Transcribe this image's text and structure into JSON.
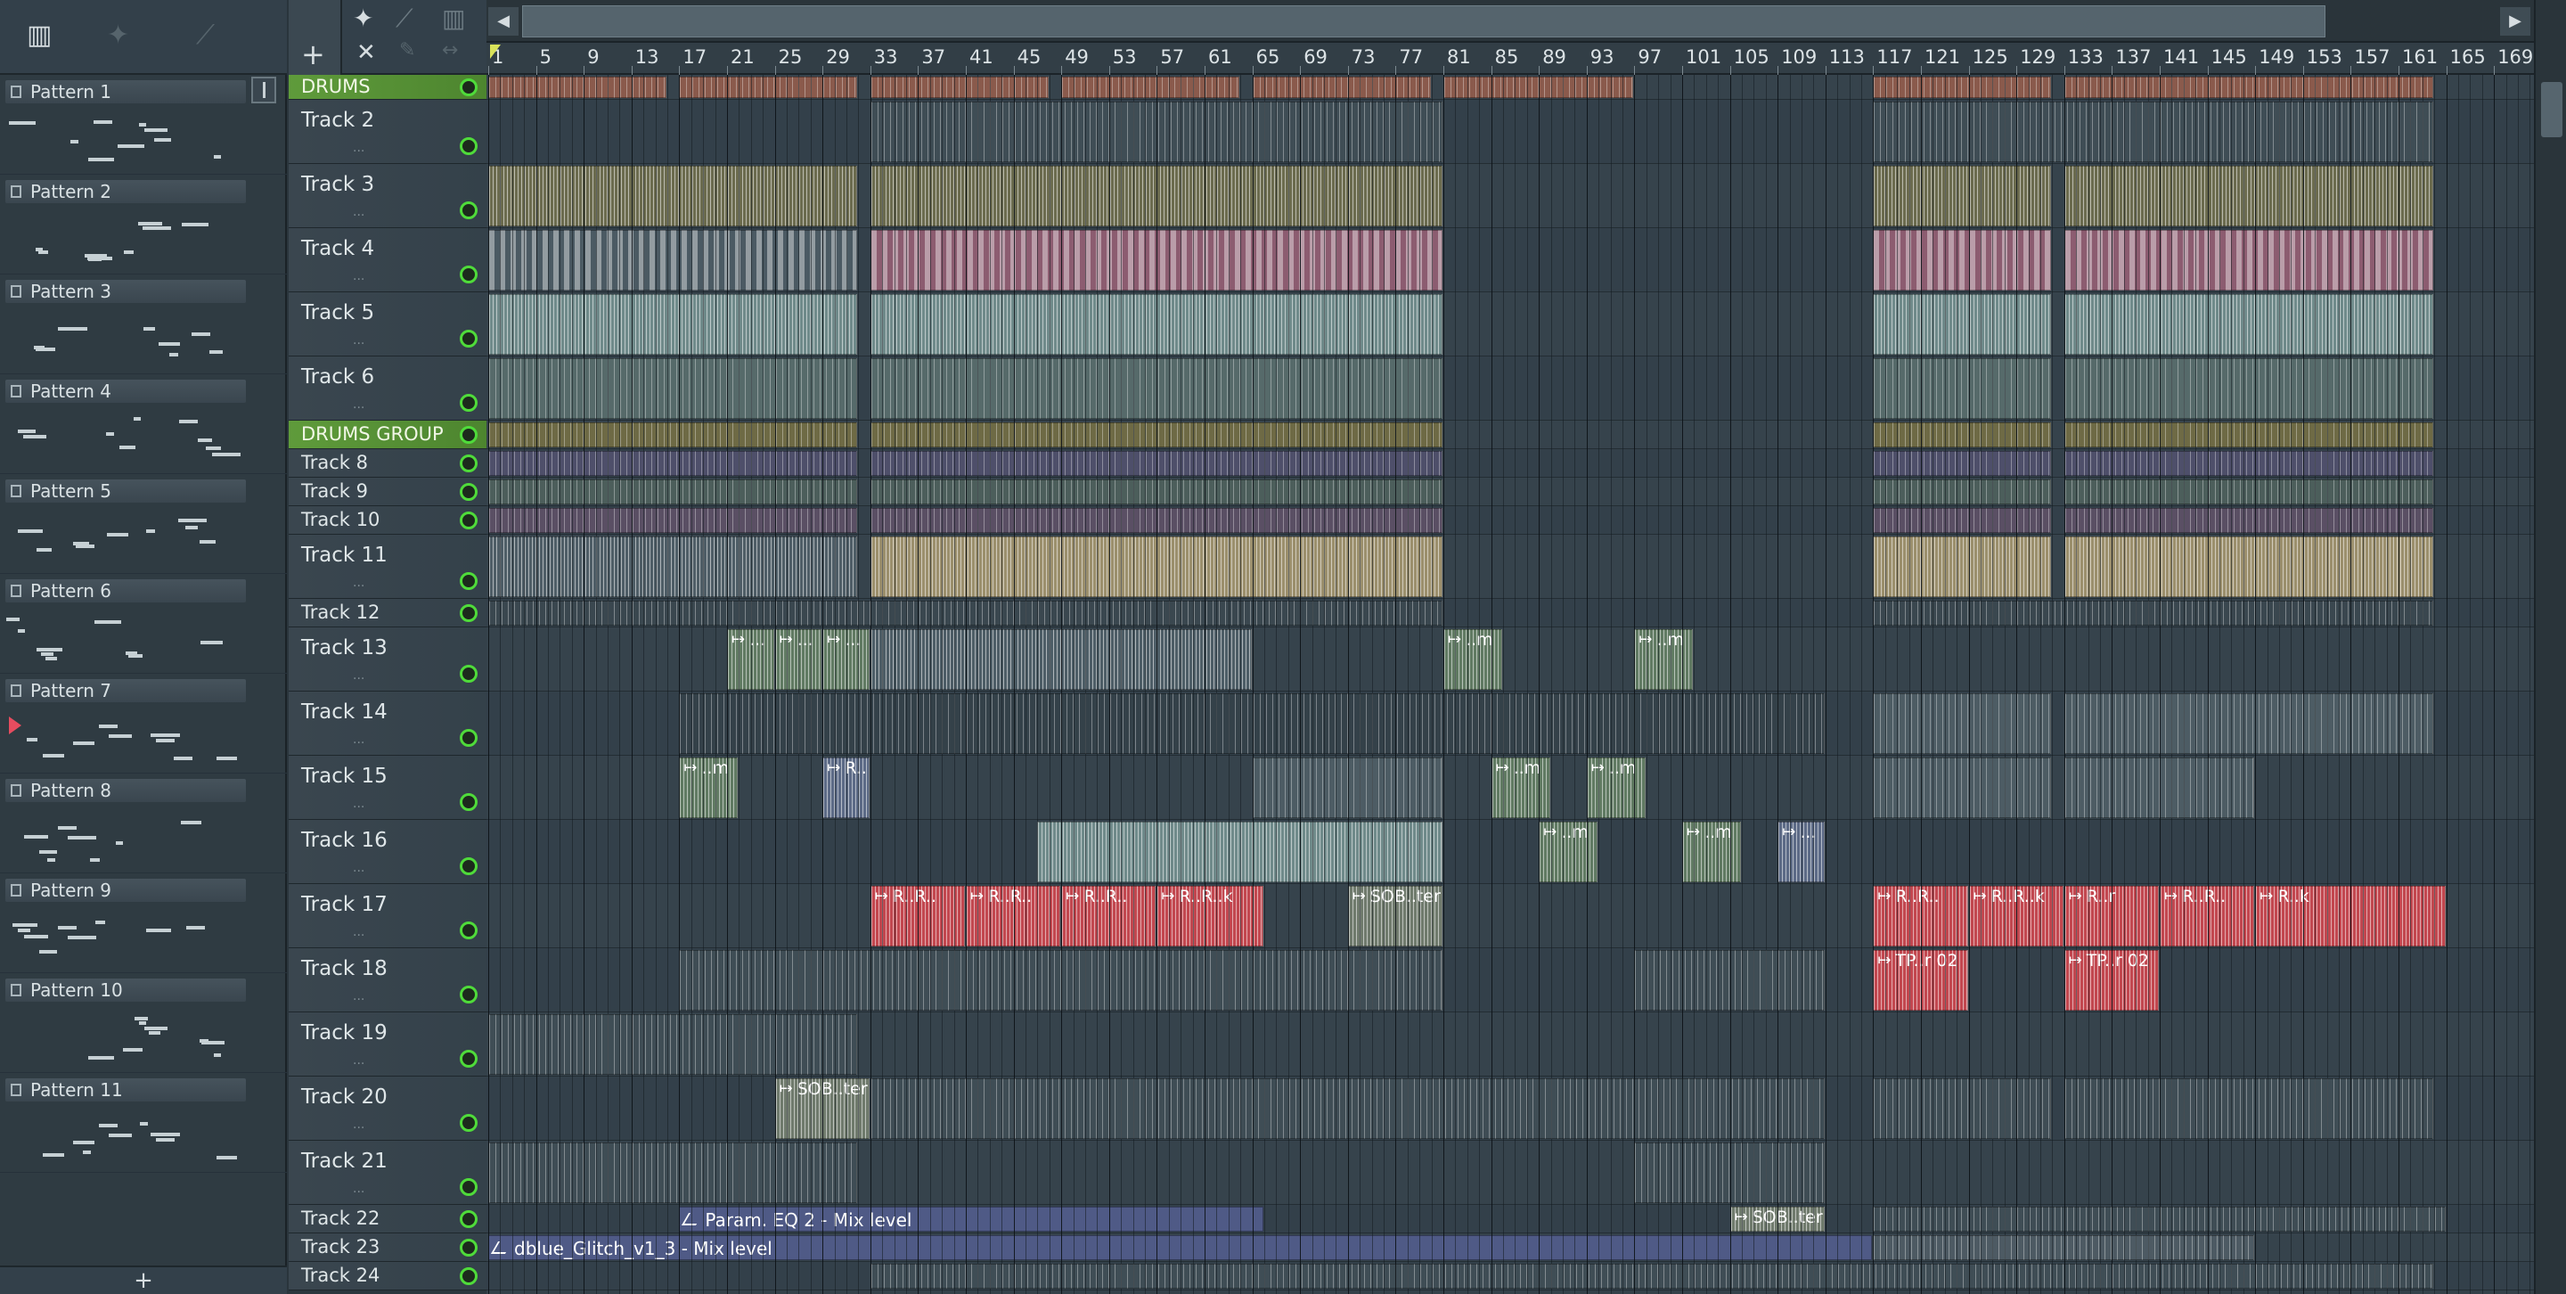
{
  "picker": {
    "add_label": "+",
    "patterns": [
      {
        "name": "Pattern 1"
      },
      {
        "name": "Pattern 2"
      },
      {
        "name": "Pattern 3"
      },
      {
        "name": "Pattern 4"
      },
      {
        "name": "Pattern 5"
      },
      {
        "name": "Pattern 6"
      },
      {
        "name": "Pattern 7"
      },
      {
        "name": "Pattern 8"
      },
      {
        "name": "Pattern 9"
      },
      {
        "name": "Pattern 10"
      },
      {
        "name": "Pattern 11"
      }
    ]
  },
  "ruler": {
    "bars": [
      "1",
      "5",
      "9",
      "13",
      "17",
      "21",
      "25",
      "29",
      "33",
      "37",
      "41",
      "45",
      "49",
      "53",
      "57",
      "61",
      "65",
      "69",
      "73",
      "77",
      "81",
      "85",
      "89",
      "93",
      "97",
      "101",
      "105",
      "109",
      "113",
      "117",
      "121",
      "125",
      "129",
      "133",
      "137",
      "141",
      "145",
      "149",
      "153",
      "157",
      "161",
      "165",
      "169"
    ]
  },
  "tracks": [
    {
      "name": "DRUMS",
      "group": true,
      "h": 28
    },
    {
      "name": "Track 2",
      "h": 72,
      "dots": "..."
    },
    {
      "name": "Track 3",
      "h": 72,
      "dots": "..."
    },
    {
      "name": "Track 4",
      "h": 72,
      "dots": "..."
    },
    {
      "name": "Track 5",
      "h": 72,
      "dots": "..."
    },
    {
      "name": "Track 6",
      "h": 72,
      "dots": "..."
    },
    {
      "name": "DRUMS GROUP",
      "group": true,
      "h": 32
    },
    {
      "name": "Track 8",
      "h": 32
    },
    {
      "name": "Track 9",
      "h": 32
    },
    {
      "name": "Track 10",
      "h": 32
    },
    {
      "name": "Track 11",
      "h": 72,
      "dots": "..."
    },
    {
      "name": "Track 12",
      "h": 32
    },
    {
      "name": "Track 13",
      "h": 72,
      "dots": "..."
    },
    {
      "name": "Track 14",
      "h": 72,
      "dots": "..."
    },
    {
      "name": "Track 15",
      "h": 72,
      "dots": "..."
    },
    {
      "name": "Track 16",
      "h": 72,
      "dots": "..."
    },
    {
      "name": "Track 17",
      "h": 72,
      "dots": "..."
    },
    {
      "name": "Track 18",
      "h": 72,
      "dots": "..."
    },
    {
      "name": "Track 19",
      "h": 72,
      "dots": "..."
    },
    {
      "name": "Track 20",
      "h": 72,
      "dots": "..."
    },
    {
      "name": "Track 21",
      "h": 72,
      "dots": "..."
    },
    {
      "name": "Track 22",
      "h": 32
    },
    {
      "name": "Track 23",
      "h": 32
    },
    {
      "name": "Track 24",
      "h": 32
    }
  ],
  "clips": [
    {
      "track": 0,
      "start": 1,
      "end": 16,
      "color": "#8a5a4c",
      "style": "stripe"
    },
    {
      "track": 0,
      "start": 17,
      "end": 32,
      "color": "#8a5a4c",
      "style": "stripe"
    },
    {
      "track": 0,
      "start": 33,
      "end": 48,
      "color": "#8a5a4c",
      "style": "stripe"
    },
    {
      "track": 0,
      "start": 49,
      "end": 64,
      "color": "#8a5a4c",
      "style": "stripe"
    },
    {
      "track": 0,
      "start": 65,
      "end": 80,
      "color": "#8a5a4c",
      "style": "stripe"
    },
    {
      "track": 0,
      "start": 81,
      "end": 97,
      "color": "#8a5a4c",
      "style": "stripe"
    },
    {
      "track": 0,
      "start": 117,
      "end": 132,
      "color": "#8a5a4c",
      "style": "stripe"
    },
    {
      "track": 0,
      "start": 133,
      "end": 164,
      "color": "#8a5a4c",
      "style": "stripe"
    },
    {
      "track": 1,
      "start": 33,
      "end": 81,
      "color": "#3f4d55",
      "style": "stripe"
    },
    {
      "track": 1,
      "start": 117,
      "end": 164,
      "color": "#3f4d55",
      "style": "stripe"
    },
    {
      "track": 2,
      "start": 1,
      "end": 32,
      "color": "#6b6b4e",
      "style": "wave"
    },
    {
      "track": 2,
      "start": 33,
      "end": 81,
      "color": "#6b6b4e",
      "style": "wave"
    },
    {
      "track": 2,
      "start": 117,
      "end": 132,
      "color": "#6b6b4e",
      "style": "wave"
    },
    {
      "track": 2,
      "start": 133,
      "end": 164,
      "color": "#6b6b4e",
      "style": "wave"
    },
    {
      "track": 3,
      "start": 1,
      "end": 32,
      "color": "#4b5a63",
      "style": "notes"
    },
    {
      "track": 3,
      "start": 33,
      "end": 81,
      "color": "#8c5c70",
      "style": "notes"
    },
    {
      "track": 3,
      "start": 117,
      "end": 132,
      "color": "#8c5c70",
      "style": "notes"
    },
    {
      "track": 3,
      "start": 133,
      "end": 164,
      "color": "#8c5c70",
      "style": "notes"
    },
    {
      "track": 4,
      "start": 1,
      "end": 32,
      "color": "#6f8a8a",
      "style": "wave"
    },
    {
      "track": 4,
      "start": 33,
      "end": 81,
      "color": "#6f8a8a",
      "style": "wave"
    },
    {
      "track": 4,
      "start": 117,
      "end": 132,
      "color": "#6f8a8a",
      "style": "wave"
    },
    {
      "track": 4,
      "start": 133,
      "end": 164,
      "color": "#6f8a8a",
      "style": "wave"
    },
    {
      "track": 5,
      "start": 1,
      "end": 32,
      "color": "#566a6a",
      "style": "stripe"
    },
    {
      "track": 5,
      "start": 33,
      "end": 81,
      "color": "#566a6a",
      "style": "stripe"
    },
    {
      "track": 5,
      "start": 117,
      "end": 132,
      "color": "#566a6a",
      "style": "stripe"
    },
    {
      "track": 5,
      "start": 133,
      "end": 164,
      "color": "#566a6a",
      "style": "stripe"
    },
    {
      "track": 6,
      "start": 1,
      "end": 32,
      "color": "#6e6a45",
      "style": "stripe"
    },
    {
      "track": 6,
      "start": 33,
      "end": 81,
      "color": "#6e6a45",
      "style": "stripe"
    },
    {
      "track": 6,
      "start": 117,
      "end": 132,
      "color": "#6e6a45",
      "style": "stripe"
    },
    {
      "track": 6,
      "start": 133,
      "end": 164,
      "color": "#6e6a45",
      "style": "stripe"
    },
    {
      "track": 7,
      "start": 1,
      "end": 32,
      "color": "#4e4f6a",
      "style": "stripe"
    },
    {
      "track": 7,
      "start": 33,
      "end": 81,
      "color": "#4e4f6a",
      "style": "stripe"
    },
    {
      "track": 7,
      "start": 117,
      "end": 132,
      "color": "#4e4f6a",
      "style": "stripe"
    },
    {
      "track": 7,
      "start": 133,
      "end": 164,
      "color": "#4e4f6a",
      "style": "stripe"
    },
    {
      "track": 8,
      "start": 1,
      "end": 32,
      "color": "#4c5e5b",
      "style": "stripe"
    },
    {
      "track": 8,
      "start": 33,
      "end": 81,
      "color": "#4c5e5b",
      "style": "stripe"
    },
    {
      "track": 8,
      "start": 117,
      "end": 132,
      "color": "#4c5e5b",
      "style": "stripe"
    },
    {
      "track": 8,
      "start": 133,
      "end": 164,
      "color": "#4c5e5b",
      "style": "stripe"
    },
    {
      "track": 9,
      "start": 1,
      "end": 32,
      "color": "#5a4f64",
      "style": "stripe"
    },
    {
      "track": 9,
      "start": 33,
      "end": 81,
      "color": "#5a4f64",
      "style": "stripe"
    },
    {
      "track": 9,
      "start": 117,
      "end": 132,
      "color": "#5a4f64",
      "style": "stripe"
    },
    {
      "track": 9,
      "start": 133,
      "end": 164,
      "color": "#5a4f64",
      "style": "stripe"
    },
    {
      "track": 10,
      "start": 1,
      "end": 32,
      "color": "#4e5d66",
      "style": "wave"
    },
    {
      "track": 10,
      "start": 33,
      "end": 81,
      "color": "#9b8f6c",
      "style": "wave"
    },
    {
      "track": 10,
      "start": 117,
      "end": 132,
      "color": "#9b8f6c",
      "style": "wave"
    },
    {
      "track": 10,
      "start": 133,
      "end": 164,
      "color": "#9b8f6c",
      "style": "wave"
    },
    {
      "track": 11,
      "start": 1,
      "end": 81,
      "color": "#3a474f",
      "style": "stripe"
    },
    {
      "track": 11,
      "start": 117,
      "end": 164,
      "color": "#3a474f",
      "style": "stripe"
    },
    {
      "track": 12,
      "start": 21,
      "end": 25,
      "color": "#607a62",
      "style": "wave",
      "label": "..."
    },
    {
      "track": 12,
      "start": 25,
      "end": 29,
      "color": "#607a62",
      "style": "wave",
      "label": "..."
    },
    {
      "track": 12,
      "start": 29,
      "end": 33,
      "color": "#607a62",
      "style": "wave",
      "label": "..."
    },
    {
      "track": 12,
      "start": 33,
      "end": 65,
      "color": "#4d5d66",
      "style": "wave"
    },
    {
      "track": 12,
      "start": 81,
      "end": 86,
      "color": "#607a62",
      "style": "wave",
      "label": "..m"
    },
    {
      "track": 12,
      "start": 97,
      "end": 102,
      "color": "#607a62",
      "style": "wave",
      "label": "..m"
    },
    {
      "track": 13,
      "start": 17,
      "end": 113,
      "color": "#344149",
      "style": "stripe"
    },
    {
      "track": 13,
      "start": 117,
      "end": 132,
      "color": "#4d5c64",
      "style": "stripe"
    },
    {
      "track": 13,
      "start": 133,
      "end": 164,
      "color": "#4d5c64",
      "style": "stripe"
    },
    {
      "track": 14,
      "start": 17,
      "end": 22,
      "color": "#607a62",
      "style": "wave",
      "label": "..m"
    },
    {
      "track": 14,
      "start": 29,
      "end": 33,
      "color": "#5c6a86",
      "style": "wave",
      "label": "R.."
    },
    {
      "track": 14,
      "start": 65,
      "end": 81,
      "color": "#4d5c64",
      "style": "stripe"
    },
    {
      "track": 14,
      "start": 85,
      "end": 90,
      "color": "#607a62",
      "style": "wave",
      "label": "..m"
    },
    {
      "track": 14,
      "start": 93,
      "end": 98,
      "color": "#607a62",
      "style": "wave",
      "label": "..m"
    },
    {
      "track": 14,
      "start": 117,
      "end": 132,
      "color": "#4d5c64",
      "style": "stripe"
    },
    {
      "track": 14,
      "start": 133,
      "end": 149,
      "color": "#4d5c64",
      "style": "stripe"
    },
    {
      "track": 15,
      "start": 47,
      "end": 81,
      "color": "#6f8a8a",
      "style": "wave"
    },
    {
      "track": 15,
      "start": 89,
      "end": 94,
      "color": "#607a62",
      "style": "wave",
      "label": "..m"
    },
    {
      "track": 15,
      "start": 101,
      "end": 106,
      "color": "#607a62",
      "style": "wave",
      "label": "..m"
    },
    {
      "track": 15,
      "start": 109,
      "end": 113,
      "color": "#5c6a86",
      "style": "wave",
      "label": "..."
    },
    {
      "track": 16,
      "start": 33,
      "end": 41,
      "color": "#c2474f",
      "style": "wave",
      "label": "R..R.."
    },
    {
      "track": 16,
      "start": 41,
      "end": 49,
      "color": "#c2474f",
      "style": "wave",
      "label": "R..R.."
    },
    {
      "track": 16,
      "start": 49,
      "end": 57,
      "color": "#c2474f",
      "style": "wave",
      "label": "R..R.."
    },
    {
      "track": 16,
      "start": 57,
      "end": 66,
      "color": "#c2474f",
      "style": "wave",
      "label": "R..R..k"
    },
    {
      "track": 16,
      "start": 73,
      "end": 81,
      "color": "#6f7a6c",
      "style": "wave",
      "label": "SOB..ter"
    },
    {
      "track": 16,
      "start": 117,
      "end": 125,
      "color": "#c2474f",
      "style": "wave",
      "label": "R..R.."
    },
    {
      "track": 16,
      "start": 125,
      "end": 133,
      "color": "#c2474f",
      "style": "wave",
      "label": "R..R..k"
    },
    {
      "track": 16,
      "start": 133,
      "end": 141,
      "color": "#c2474f",
      "style": "wave",
      "label": "R..r"
    },
    {
      "track": 16,
      "start": 141,
      "end": 149,
      "color": "#c2474f",
      "style": "wave",
      "label": "R..R.."
    },
    {
      "track": 16,
      "start": 149,
      "end": 165,
      "color": "#c2474f",
      "style": "wave",
      "label": "R..k"
    },
    {
      "track": 17,
      "start": 17,
      "end": 81,
      "color": "#3f4d55",
      "style": "stripe"
    },
    {
      "track": 17,
      "start": 97,
      "end": 113,
      "color": "#3f4d55",
      "style": "stripe"
    },
    {
      "track": 17,
      "start": 117,
      "end": 125,
      "color": "#c2474f",
      "style": "wave",
      "label": "TP..r 02"
    },
    {
      "track": 17,
      "start": 133,
      "end": 141,
      "color": "#c2474f",
      "style": "wave",
      "label": "TP..r 02"
    },
    {
      "track": 18,
      "start": 1,
      "end": 32,
      "color": "#3f4d55",
      "style": "stripe"
    },
    {
      "track": 19,
      "start": 25,
      "end": 33,
      "color": "#6f7a6c",
      "style": "wave",
      "label": "SOB..ter"
    },
    {
      "track": 19,
      "start": 33,
      "end": 113,
      "color": "#3f4d55",
      "style": "stripe"
    },
    {
      "track": 19,
      "start": 117,
      "end": 132,
      "color": "#3f4d55",
      "style": "stripe"
    },
    {
      "track": 19,
      "start": 133,
      "end": 164,
      "color": "#3f4d55",
      "style": "stripe"
    },
    {
      "track": 20,
      "start": 1,
      "end": 32,
      "color": "#3f4d55",
      "style": "stripe"
    },
    {
      "track": 20,
      "start": 97,
      "end": 113,
      "color": "#3f4d55",
      "style": "stripe"
    },
    {
      "track": 21,
      "start": 17,
      "end": 66,
      "color": "#4f5a86",
      "style": "auto",
      "label": "Param. EQ 2 - Mix level"
    },
    {
      "track": 21,
      "start": 105,
      "end": 113,
      "color": "#6f7a6c",
      "style": "wave",
      "label": "SOB..ter"
    },
    {
      "track": 21,
      "start": 117,
      "end": 165,
      "color": "#3f4d55",
      "style": "stripe"
    },
    {
      "track": 22,
      "start": 1,
      "end": 117,
      "color": "#4f5a86",
      "style": "auto",
      "label": "dblue_Glitch_v1_3 - Mix level"
    },
    {
      "track": 22,
      "start": 117,
      "end": 149,
      "color": "#4d5a63",
      "style": "stripe"
    },
    {
      "track": 23,
      "start": 33,
      "end": 164,
      "color": "#3f4d55",
      "style": "stripe"
    }
  ],
  "colors": {
    "group_green": "#5f9b3b",
    "led_green": "#4fdb3a",
    "clip_red": "#c2474f",
    "auto_blue": "#4f5a86",
    "playhead_yellow": "#d9e35a"
  }
}
